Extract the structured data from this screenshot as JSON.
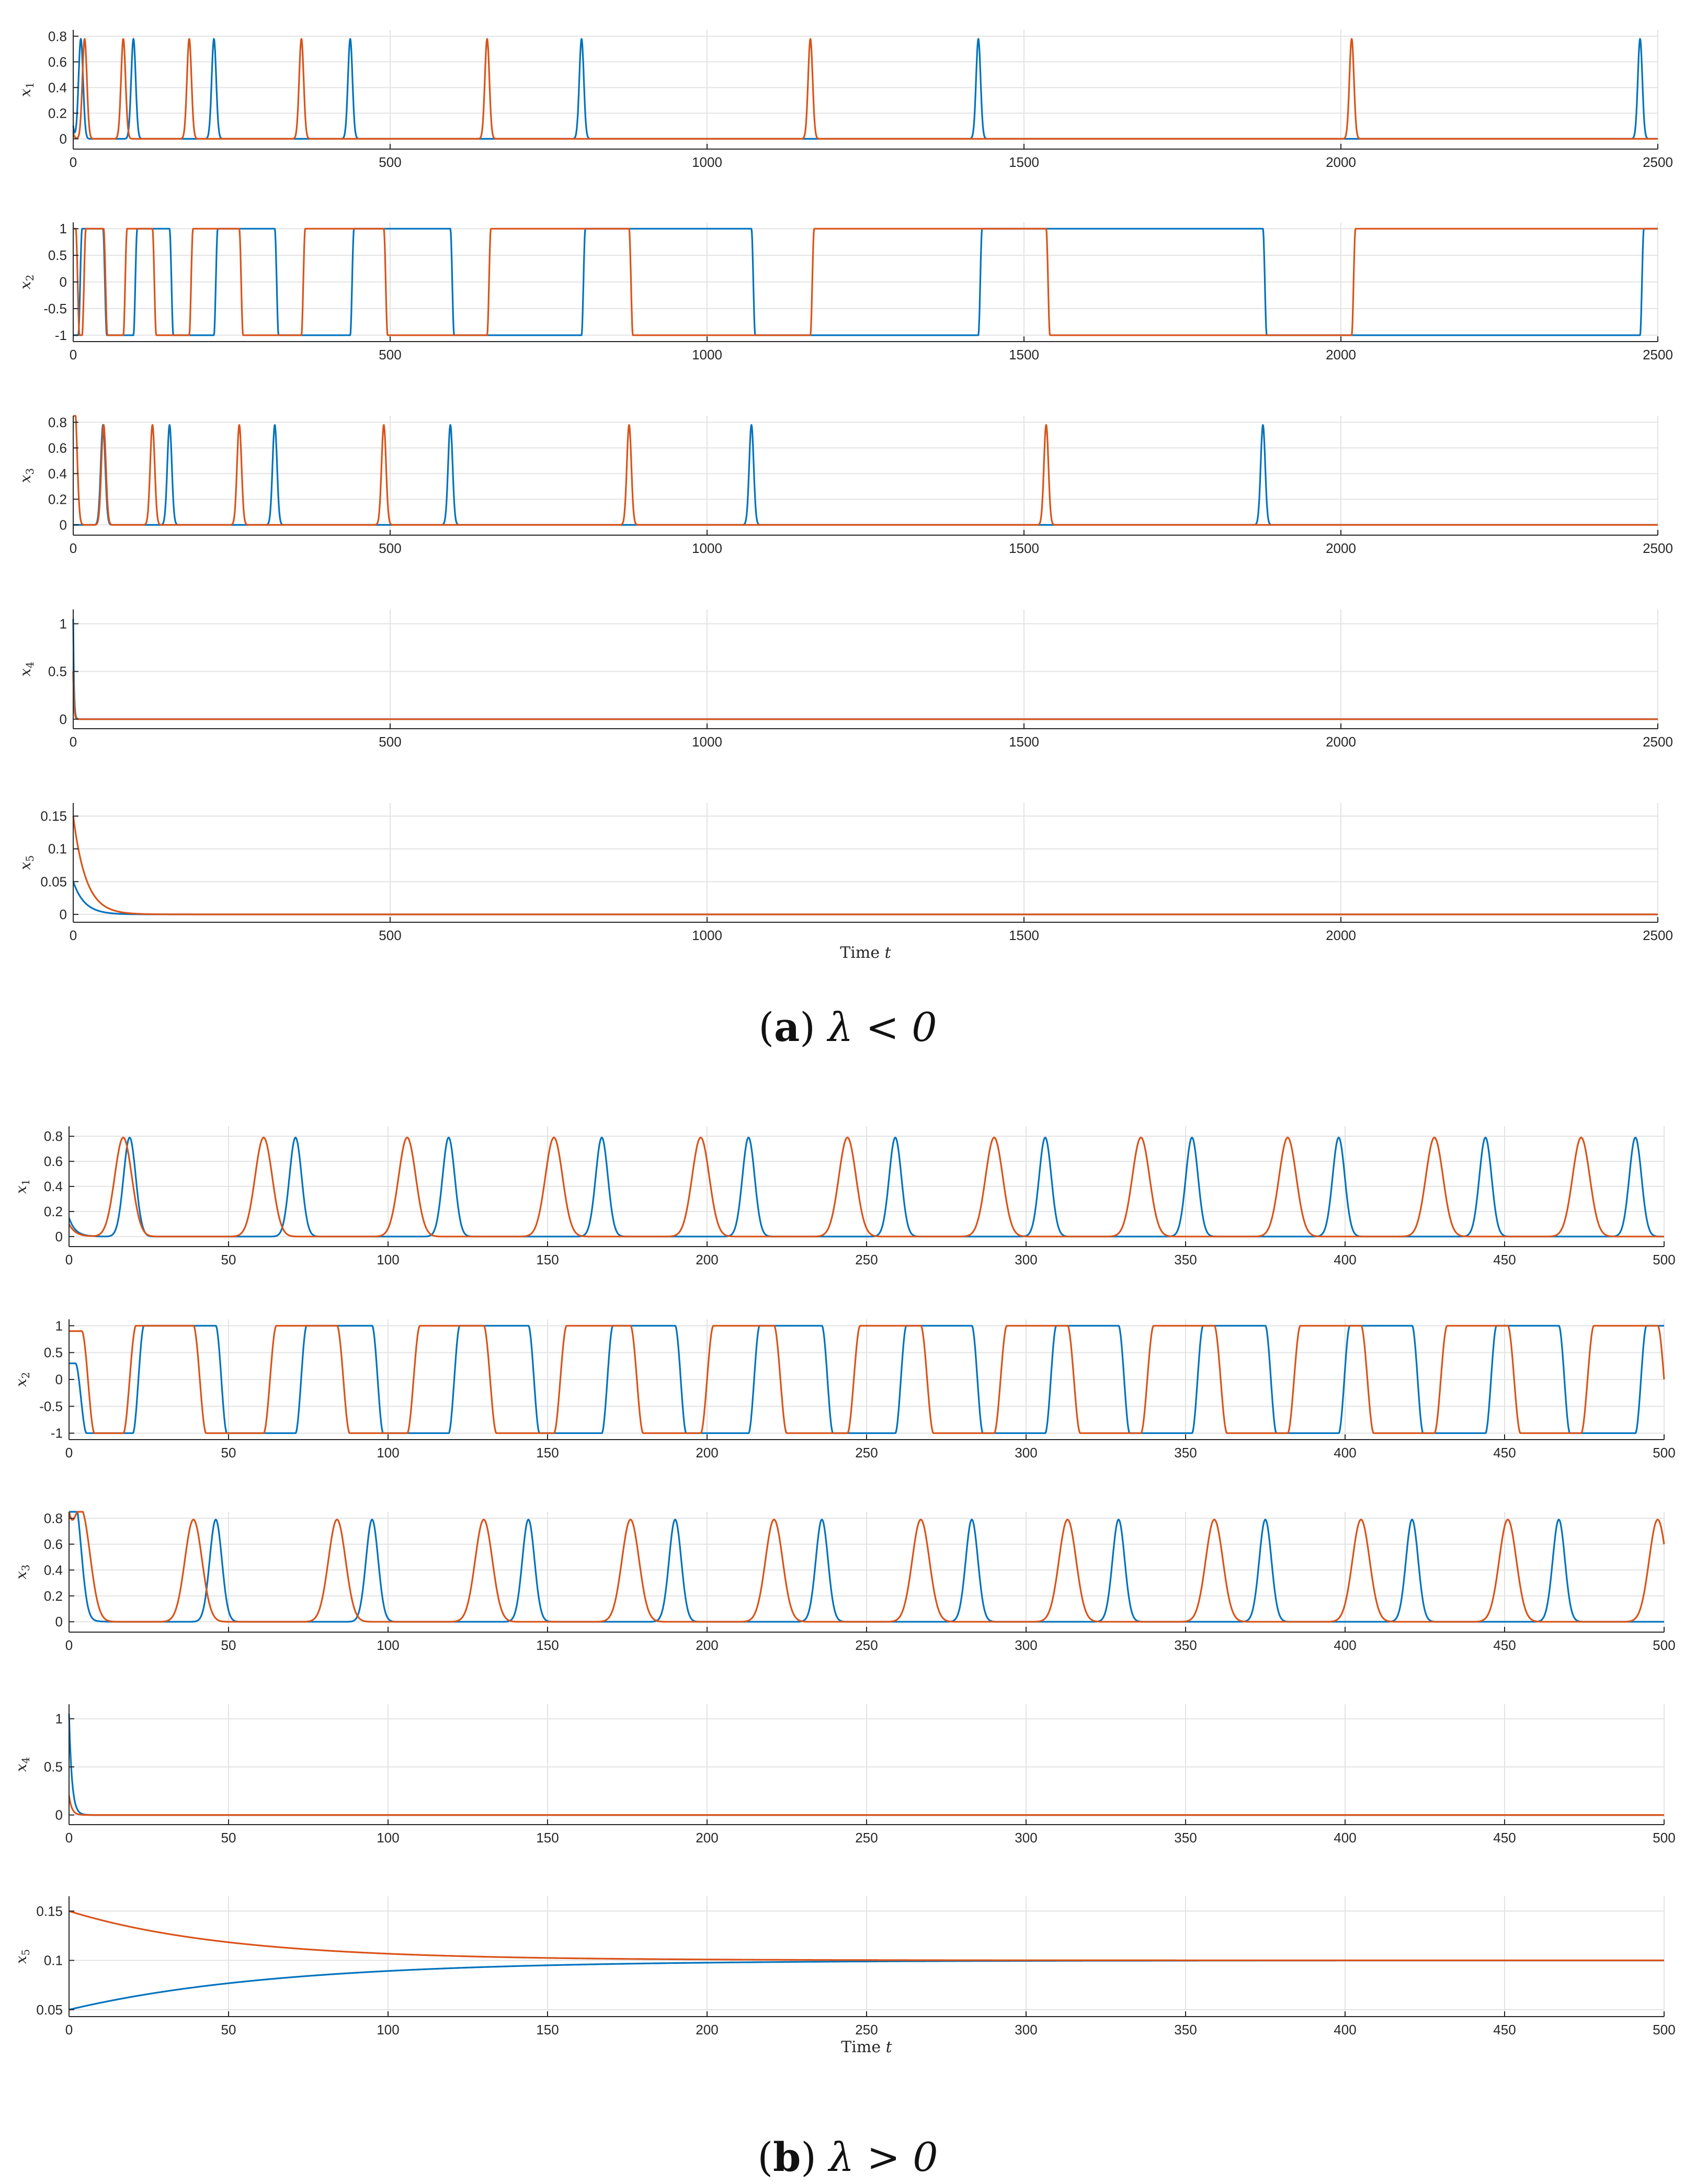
{
  "colors": {
    "series_1": "#0072BD",
    "series_2": "#D95319"
  },
  "captions": {
    "a": {
      "letter": "a",
      "expr": "λ < 0"
    },
    "b": {
      "letter": "b",
      "expr": "λ > 0"
    }
  },
  "chart_data": [
    {
      "panel": "a",
      "type": "line",
      "ylabel": "x1",
      "xlabel": "",
      "xlim": [
        0,
        2500
      ],
      "ylim": [
        -0.08,
        0.85
      ],
      "xticks": [
        0,
        500,
        1000,
        1500,
        2000,
        2500
      ],
      "yticks": [
        0,
        0.2,
        0.4,
        0.6,
        0.8
      ],
      "ytick_labels": [
        "0",
        "0.2",
        "0.4",
        "0.6",
        "0.8"
      ],
      "series": [
        {
          "color": "#0072BD",
          "kind": "spikes",
          "baseline": 0,
          "peak": 0.78,
          "width": 5,
          "start": 0.1,
          "events": [
            12,
            95,
            222,
            437,
            802,
            1428,
            2472
          ]
        },
        {
          "color": "#D95319",
          "kind": "spikes",
          "baseline": 0,
          "peak": 0.78,
          "width": 5,
          "start": 0.05,
          "events": [
            18,
            79,
            183,
            360,
            653,
            1163,
            2017
          ]
        }
      ]
    },
    {
      "panel": "a",
      "type": "line",
      "ylabel": "x2",
      "xlabel": "",
      "xlim": [
        0,
        2500
      ],
      "ylim": [
        -1.12,
        1.12
      ],
      "xticks": [
        0,
        500,
        1000,
        1500,
        2000,
        2500
      ],
      "yticks": [
        -1,
        -0.5,
        0,
        0.5,
        1
      ],
      "ytick_labels": [
        "-1",
        "-0.5",
        "0",
        "0.5",
        "1"
      ],
      "series": [
        {
          "color": "#0072BD",
          "kind": "square",
          "low": -1,
          "high": 1,
          "ramp": 6,
          "start": -1,
          "rises": [
            8,
            95,
            222,
            437,
            802,
            1428,
            2472
          ],
          "falls": [
            47,
            152,
            318,
            595,
            1070,
            1877
          ]
        },
        {
          "color": "#D95319",
          "kind": "square",
          "low": -1,
          "high": 1,
          "ramp": 6,
          "start": 1,
          "rises": [
            14,
            79,
            183,
            360,
            653,
            1163,
            2017
          ],
          "falls": [
            4,
            48,
            125,
            262,
            490,
            877,
            1535
          ]
        }
      ]
    },
    {
      "panel": "a",
      "type": "line",
      "ylabel": "x3",
      "xlabel": "",
      "xlim": [
        0,
        2500
      ],
      "ylim": [
        -0.08,
        0.85
      ],
      "xticks": [
        0,
        500,
        1000,
        1500,
        2000,
        2500
      ],
      "yticks": [
        0,
        0.2,
        0.4,
        0.6,
        0.8
      ],
      "ytick_labels": [
        "0",
        "0.2",
        "0.4",
        "0.6",
        "0.8"
      ],
      "series": [
        {
          "color": "#0072BD",
          "kind": "spikes",
          "baseline": 0,
          "peak": 0.78,
          "width": 5,
          "start": 0,
          "events": [
            47,
            152,
            318,
            595,
            1070,
            1877
          ]
        },
        {
          "color": "#D95319",
          "kind": "spikes",
          "baseline": 0,
          "peak": 0.78,
          "width": 5,
          "start": 0.78,
          "events": [
            3,
            48,
            125,
            262,
            490,
            877,
            1535
          ]
        }
      ]
    },
    {
      "panel": "a",
      "type": "line",
      "ylabel": "x4",
      "xlabel": "",
      "xlim": [
        0,
        2500
      ],
      "ylim": [
        -0.1,
        1.15
      ],
      "xticks": [
        0,
        500,
        1000,
        1500,
        2000,
        2500
      ],
      "yticks": [
        0,
        0.5,
        1
      ],
      "ytick_labels": [
        "0",
        "0.5",
        "1"
      ],
      "series": [
        {
          "color": "#0072BD",
          "kind": "decay",
          "start": 1.05,
          "end": 0,
          "tau": 1.2
        },
        {
          "color": "#D95319",
          "kind": "decay",
          "start": 0.5,
          "end": 0,
          "tau": 1.2
        }
      ]
    },
    {
      "panel": "a",
      "type": "line",
      "ylabel": "x5",
      "xlabel": "Time t",
      "xlim": [
        0,
        2500
      ],
      "ylim": [
        -0.012,
        0.17
      ],
      "xticks": [
        0,
        500,
        1000,
        1500,
        2000,
        2500
      ],
      "yticks": [
        0,
        0.05,
        0.1,
        0.15
      ],
      "ytick_labels": [
        "0",
        "0.05",
        "0.1",
        "0.15"
      ],
      "series": [
        {
          "color": "#0072BD",
          "kind": "decay",
          "start": 0.05,
          "end": 0,
          "tau": 18
        },
        {
          "color": "#D95319",
          "kind": "decay",
          "start": 0.15,
          "end": 0,
          "tau": 20
        }
      ]
    },
    {
      "panel": "b",
      "type": "line",
      "ylabel": "x1",
      "xlabel": "",
      "xlim": [
        0,
        500
      ],
      "ylim": [
        -0.08,
        0.88
      ],
      "xticks": [
        0,
        50,
        100,
        150,
        200,
        250,
        300,
        350,
        400,
        450,
        500
      ],
      "yticks": [
        0,
        0.2,
        0.4,
        0.6,
        0.8
      ],
      "ytick_labels": [
        "0",
        "0.2",
        "0.4",
        "0.6",
        "0.8"
      ],
      "series": [
        {
          "color": "#0072BD",
          "kind": "spikes",
          "baseline": 0,
          "peak": 0.79,
          "width": 2.7,
          "start": 0.15,
          "events": [
            19,
            71,
            119,
            167,
            213,
            259,
            306,
            352,
            398,
            444,
            491
          ]
        },
        {
          "color": "#D95319",
          "kind": "spikes",
          "baseline": 0,
          "peak": 0.79,
          "width": 3.8,
          "start": 0.1,
          "events": [
            17,
            61,
            106,
            152,
            198,
            244,
            290,
            336,
            382,
            428,
            474
          ]
        }
      ]
    },
    {
      "panel": "b",
      "type": "line",
      "ylabel": "x2",
      "xlabel": "",
      "xlim": [
        0,
        500
      ],
      "ylim": [
        -1.12,
        1.12
      ],
      "xticks": [
        0,
        50,
        100,
        150,
        200,
        250,
        300,
        350,
        400,
        450,
        500
      ],
      "yticks": [
        -1,
        -0.5,
        0,
        0.5,
        1
      ],
      "ytick_labels": [
        "-1",
        "-0.5",
        "0",
        "0.5",
        "1"
      ],
      "series": [
        {
          "color": "#0072BD",
          "kind": "square",
          "low": -1,
          "high": 1,
          "ramp": 3.5,
          "start": 0.3,
          "rises": [
            20,
            71,
            119,
            167,
            213,
            259,
            306,
            352,
            398,
            444,
            491
          ],
          "falls": [
            2,
            46,
            95,
            144,
            190,
            236,
            283,
            329,
            375,
            421,
            467
          ]
        },
        {
          "color": "#D95319",
          "kind": "square",
          "low": -1,
          "high": 1,
          "ramp": 4,
          "start": 0.9,
          "rises": [
            17,
            61,
            106,
            152,
            198,
            244,
            290,
            336,
            382,
            428,
            474
          ],
          "falls": [
            4,
            39,
            84,
            130,
            176,
            221,
            267,
            313,
            359,
            405,
            451,
            498
          ]
        }
      ]
    },
    {
      "panel": "b",
      "type": "line",
      "ylabel": "x3",
      "xlabel": "",
      "xlim": [
        0,
        500
      ],
      "ylim": [
        -0.08,
        0.85
      ],
      "xticks": [
        0,
        50,
        100,
        150,
        200,
        250,
        300,
        350,
        400,
        450,
        500
      ],
      "yticks": [
        0,
        0.2,
        0.4,
        0.6,
        0.8
      ],
      "ytick_labels": [
        "0",
        "0.2",
        "0.4",
        "0.6",
        "0.8"
      ],
      "series": [
        {
          "color": "#0072BD",
          "kind": "spikes",
          "baseline": 0,
          "peak": 0.79,
          "width": 2.7,
          "start": 0.4,
          "events": [
            2,
            46,
            95,
            144,
            190,
            236,
            283,
            329,
            375,
            421,
            467
          ]
        },
        {
          "color": "#D95319",
          "kind": "spikes",
          "baseline": 0,
          "peak": 0.79,
          "width": 3.8,
          "start": 0.6,
          "events": [
            4,
            39,
            84,
            130,
            176,
            221,
            267,
            313,
            359,
            405,
            451,
            498
          ]
        }
      ]
    },
    {
      "panel": "b",
      "type": "line",
      "ylabel": "x4",
      "xlabel": "",
      "xlim": [
        0,
        500
      ],
      "ylim": [
        -0.1,
        1.15
      ],
      "xticks": [
        0,
        50,
        100,
        150,
        200,
        250,
        300,
        350,
        400,
        450,
        500
      ],
      "yticks": [
        0,
        0.5,
        1
      ],
      "ytick_labels": [
        "0",
        "0.5",
        "1"
      ],
      "series": [
        {
          "color": "#0072BD",
          "kind": "decay",
          "start": 1.05,
          "end": 0,
          "tau": 0.9
        },
        {
          "color": "#D95319",
          "kind": "decay",
          "start": 0.2,
          "end": 0,
          "tau": 0.9
        }
      ]
    },
    {
      "panel": "b",
      "type": "line",
      "ylabel": "x5",
      "xlabel": "Time t",
      "xlim": [
        0,
        500
      ],
      "ylim": [
        0.043,
        0.165
      ],
      "xticks": [
        0,
        50,
        100,
        150,
        200,
        250,
        300,
        350,
        400,
        450,
        500
      ],
      "yticks": [
        0.05,
        0.1,
        0.15
      ],
      "ytick_labels": [
        "0.05",
        "0.1",
        "0.15"
      ],
      "series": [
        {
          "color": "#0072BD",
          "kind": "decay",
          "start": 0.05,
          "end": 0.1,
          "tau": 65
        },
        {
          "color": "#D95319",
          "kind": "decay",
          "start": 0.15,
          "end": 0.1,
          "tau": 50
        }
      ]
    }
  ]
}
